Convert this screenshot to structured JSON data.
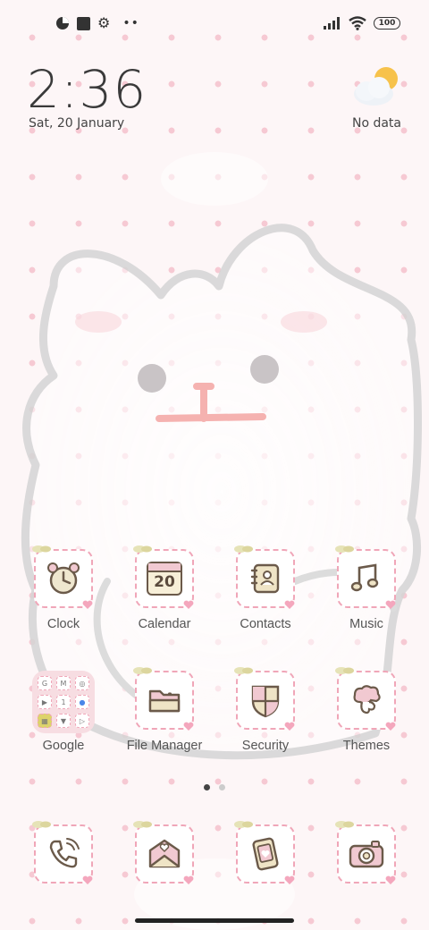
{
  "status_bar": {
    "icons_left": [
      "data-saver-icon",
      "square-notification-icon",
      "settings-gear-icon",
      "more-dots-icon"
    ],
    "icons_right": [
      "signal-icon",
      "wifi-icon"
    ],
    "battery_level": "100"
  },
  "clock_widget": {
    "time": "2:36",
    "date": "Sat, 20 January"
  },
  "weather_widget": {
    "icon": "partly-cloudy-icon",
    "status": "No data"
  },
  "apps": [
    {
      "label": "Clock",
      "icon": "alarm-clock-icon"
    },
    {
      "label": "Calendar",
      "icon": "calendar-icon",
      "badge": "20"
    },
    {
      "label": "Contacts",
      "icon": "contacts-notebook-icon"
    },
    {
      "label": "Music",
      "icon": "music-note-icon"
    },
    {
      "label": "Google",
      "icon": "google-folder-icon"
    },
    {
      "label": "File Manager",
      "icon": "folder-icon"
    },
    {
      "label": "Security",
      "icon": "shield-icon"
    },
    {
      "label": "Themes",
      "icon": "themes-icon"
    }
  ],
  "google_folder_apps": [
    "G",
    "M",
    "◎",
    "▶",
    "1",
    "●",
    "▦",
    "▼",
    "▷"
  ],
  "dock": [
    {
      "icon": "phone-icon"
    },
    {
      "icon": "messages-envelope-icon"
    },
    {
      "icon": "gallery-icon"
    },
    {
      "icon": "camera-icon"
    }
  ],
  "page_indicator": {
    "pages": 2,
    "current": 1
  },
  "colors": {
    "background": "#fdf6f7",
    "pattern_dot": "#f6c9d3",
    "icon_border": "#f0a6b8",
    "text": "#3a3a3a"
  }
}
